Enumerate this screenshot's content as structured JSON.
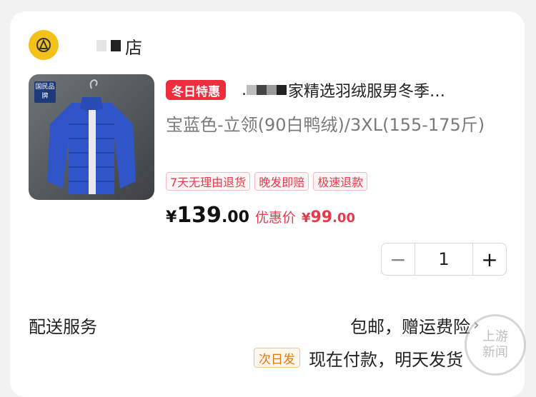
{
  "shop": {
    "name_suffix": "店",
    "logo_icon": "shop-logo-icon"
  },
  "product": {
    "brand_badge": "国民品牌",
    "promo_tag": "冬日特惠",
    "title_prefix": ".",
    "title": "家精选羽绒服男冬季…",
    "spec": "宝蓝色-立领(90白鸭绒)/3XL(155-175斤)",
    "service_tags": [
      "7天无理由退货",
      "晚发即赔",
      "极速退款"
    ],
    "price_symbol": "¥",
    "price_int": "139",
    "price_dec": ".00",
    "discount_label": "优惠价",
    "discount_symbol": "¥",
    "discount_int": "99",
    "discount_dec": ".00",
    "image_color": "#2f55c8"
  },
  "quantity": {
    "minus": "−",
    "value": "1",
    "plus": "+"
  },
  "shipping": {
    "label": "配送服务",
    "value": "包邮，赠运费险",
    "next_day_tag": "次日发",
    "note": "现在付款，明天发货"
  },
  "watermark": {
    "line1": "上游",
    "line2": "新闻"
  }
}
